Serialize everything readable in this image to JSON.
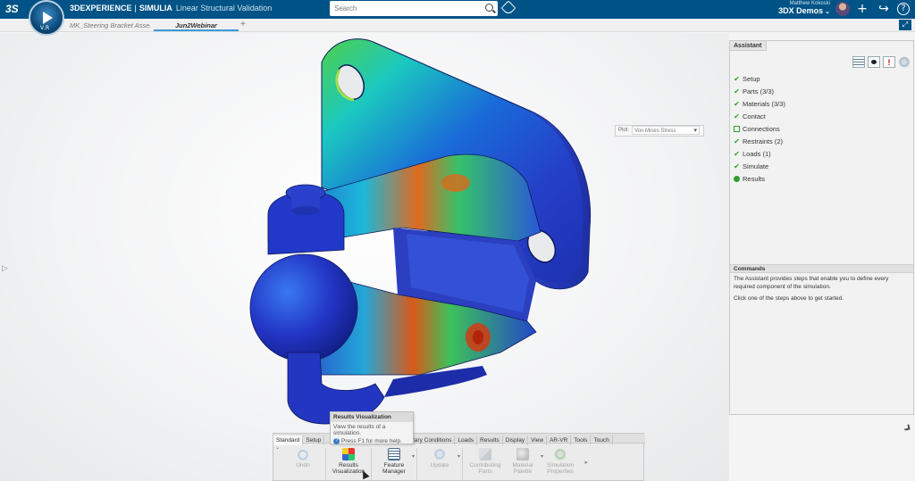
{
  "header": {
    "brand": "3DEXPERIENCE",
    "separator": "|",
    "product": "SIMULIA",
    "app_name": "Linear Structural Validation",
    "search_placeholder": "Search",
    "user_name": "Matthew Kokoski",
    "tenant": "3DX Demos",
    "tenant_chevron": "⌄",
    "compass_label": "V,R",
    "ds_logo": "3S"
  },
  "tabs": [
    {
      "label": "MK_Steering Bracket Assem",
      "active": false
    },
    {
      "label": "Jun2Webinar",
      "active": true
    }
  ],
  "tab_add": "+",
  "viewport": {
    "plot_label": "Plot:",
    "plot_value": "Von Mises Stress",
    "left_handle": "▷"
  },
  "assistant": {
    "tab_label": "Assistant",
    "steps": [
      {
        "label": "Setup",
        "status": "done"
      },
      {
        "label": "Parts (3/3)",
        "status": "done"
      },
      {
        "label": "Materials (3/3)",
        "status": "done"
      },
      {
        "label": "Contact",
        "status": "done"
      },
      {
        "label": "Connections",
        "status": "open"
      },
      {
        "label": "Restraints (2)",
        "status": "done"
      },
      {
        "label": "Loads (1)",
        "status": "done"
      },
      {
        "label": "Simulate",
        "status": "done"
      },
      {
        "label": "Results",
        "status": "dot"
      }
    ],
    "commands_title": "Commands",
    "commands_text_1": "The Assistant provides steps that enable you to define every required component of the simulation.",
    "commands_text_2": "Click one of the steps above to get started.",
    "toolbar_icons": [
      "table-icon",
      "eye-icon",
      "alert-icon",
      "gear-icon"
    ],
    "alert_glyph": "!"
  },
  "action_bar": {
    "tabs": [
      "Standard",
      "Setup",
      "Connections",
      "Connections",
      "Boundary Conditions",
      "Loads",
      "Results",
      "Display",
      "View",
      "AR-VR",
      "Tools",
      "Touch"
    ],
    "visible_tabs": [
      "Standard",
      "Setup",
      "ections",
      "Boundary Conditions",
      "Loads",
      "Results",
      "Display",
      "View",
      "AR-VR",
      "Tools",
      "Touch"
    ],
    "tools": [
      {
        "label_1": "Undo",
        "label_2": "",
        "dim": true
      },
      {
        "label_1": "Results",
        "label_2": "Visualization",
        "dim": false
      },
      {
        "label_1": "Feature",
        "label_2": "Manager",
        "dim": false
      },
      {
        "label_1": "Update",
        "label_2": "",
        "dim": true
      },
      {
        "label_1": "Contributing",
        "label_2": "Parts",
        "dim": true
      },
      {
        "label_1": "Material",
        "label_2": "Palette",
        "dim": true
      },
      {
        "label_1": "Simulation",
        "label_2": "Properties",
        "dim": true
      }
    ],
    "more_glyph": "▸",
    "collapse_glyph": "⌄"
  },
  "tooltip": {
    "title": "Results Visualization",
    "description": "View the results of a simulation.",
    "help": "Press F1 for more help.",
    "help_glyph": "?"
  },
  "colors": {
    "topbar": "#005386",
    "check": "#2f9e2f",
    "tab_underline": "#3c9ad8"
  }
}
